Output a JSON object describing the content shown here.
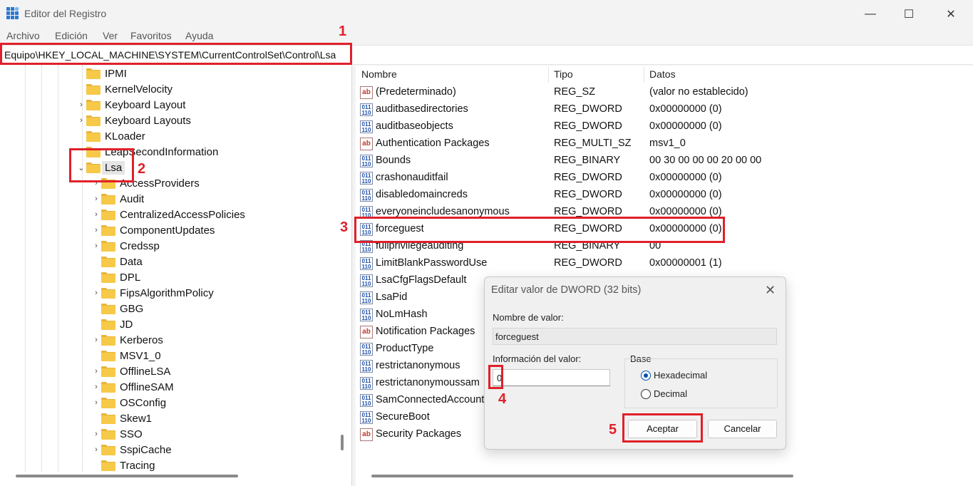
{
  "window": {
    "title": "Editor del Registro",
    "controls": {
      "minimize": "—",
      "maximize": "☐",
      "close": "✕"
    }
  },
  "menu": [
    "Archivo",
    "Edición",
    "Ver",
    "Favoritos",
    "Ayuda"
  ],
  "address": "Equipo\\HKEY_LOCAL_MACHINE\\SYSTEM\\CurrentControlSet\\Control\\Lsa",
  "annotations": {
    "n1": "1",
    "n2": "2",
    "n3": "3",
    "n4": "4",
    "n5": "5",
    "color": "#e0202a"
  },
  "tree": {
    "parents": [
      {
        "label": "IPMI",
        "expandable": false
      },
      {
        "label": "KernelVelocity",
        "expandable": false
      },
      {
        "label": "Keyboard Layout",
        "expandable": true
      },
      {
        "label": "Keyboard Layouts",
        "expandable": true
      },
      {
        "label": "KLoader",
        "expandable": false
      },
      {
        "label": "LeapSecondInformation",
        "expandable": false
      },
      {
        "label": "Lsa",
        "expandable": true,
        "expanded": true,
        "selected": true
      }
    ],
    "children": [
      {
        "label": "AccessProviders",
        "expandable": true
      },
      {
        "label": "Audit",
        "expandable": true
      },
      {
        "label": "CentralizedAccessPolicies",
        "expandable": true
      },
      {
        "label": "ComponentUpdates",
        "expandable": true
      },
      {
        "label": "Credssp",
        "expandable": true
      },
      {
        "label": "Data",
        "expandable": false
      },
      {
        "label": "DPL",
        "expandable": false
      },
      {
        "label": "FipsAlgorithmPolicy",
        "expandable": true
      },
      {
        "label": "GBG",
        "expandable": false
      },
      {
        "label": "JD",
        "expandable": false
      },
      {
        "label": "Kerberos",
        "expandable": true
      },
      {
        "label": "MSV1_0",
        "expandable": false
      },
      {
        "label": "OfflineLSA",
        "expandable": true
      },
      {
        "label": "OfflineSAM",
        "expandable": true
      },
      {
        "label": "OSConfig",
        "expandable": true
      },
      {
        "label": "Skew1",
        "expandable": false
      },
      {
        "label": "SSO",
        "expandable": true
      },
      {
        "label": "SspiCache",
        "expandable": true
      },
      {
        "label": "Tracing",
        "expandable": false
      }
    ]
  },
  "list": {
    "headers": {
      "name": "Nombre",
      "type": "Tipo",
      "data": "Datos"
    },
    "rows": [
      {
        "icon": "string-icon",
        "name": "(Predeterminado)",
        "type": "REG_SZ",
        "data": "(valor no establecido)"
      },
      {
        "icon": "binary-icon",
        "name": "auditbasedirectories",
        "type": "REG_DWORD",
        "data": "0x00000000 (0)"
      },
      {
        "icon": "binary-icon",
        "name": "auditbaseobjects",
        "type": "REG_DWORD",
        "data": "0x00000000 (0)"
      },
      {
        "icon": "string-icon",
        "name": "Authentication Packages",
        "type": "REG_MULTI_SZ",
        "data": "msv1_0"
      },
      {
        "icon": "binary-icon",
        "name": "Bounds",
        "type": "REG_BINARY",
        "data": "00 30 00 00 00 20 00 00"
      },
      {
        "icon": "binary-icon",
        "name": "crashonauditfail",
        "type": "REG_DWORD",
        "data": "0x00000000 (0)"
      },
      {
        "icon": "binary-icon",
        "name": "disabledomaincreds",
        "type": "REG_DWORD",
        "data": "0x00000000 (0)"
      },
      {
        "icon": "binary-icon",
        "name": "everyoneincludesanonymous",
        "type": "REG_DWORD",
        "data": "0x00000000 (0)"
      },
      {
        "icon": "binary-icon",
        "name": "forceguest",
        "type": "REG_DWORD",
        "data": "0x00000000 (0)"
      },
      {
        "icon": "binary-icon",
        "name": "fullprivilegeauditing",
        "type": "REG_BINARY",
        "data": "00"
      },
      {
        "icon": "binary-icon",
        "name": "LimitBlankPasswordUse",
        "type": "REG_DWORD",
        "data": "0x00000001 (1)"
      },
      {
        "icon": "binary-icon",
        "name": "LsaCfgFlagsDefault",
        "type": "",
        "data": ""
      },
      {
        "icon": "binary-icon",
        "name": "LsaPid",
        "type": "",
        "data": ""
      },
      {
        "icon": "binary-icon",
        "name": "NoLmHash",
        "type": "",
        "data": ""
      },
      {
        "icon": "string-icon",
        "name": "Notification Packages",
        "type": "",
        "data": ""
      },
      {
        "icon": "binary-icon",
        "name": "ProductType",
        "type": "",
        "data": ""
      },
      {
        "icon": "binary-icon",
        "name": "restrictanonymous",
        "type": "",
        "data": ""
      },
      {
        "icon": "binary-icon",
        "name": "restrictanonymoussam",
        "type": "",
        "data": ""
      },
      {
        "icon": "binary-icon",
        "name": "SamConnectedAccounts",
        "type": "",
        "data": ""
      },
      {
        "icon": "binary-icon",
        "name": "SecureBoot",
        "type": "",
        "data": ""
      },
      {
        "icon": "string-icon",
        "name": "Security Packages",
        "type": "",
        "data": ""
      }
    ]
  },
  "dialog": {
    "title": "Editar valor de DWORD (32 bits)",
    "close": "✕",
    "name_label": "Nombre de valor:",
    "name_value": "forceguest",
    "value_label": "Información del valor:",
    "value": "0",
    "base_label": "Base",
    "base_options": [
      {
        "label": "Hexadecimal",
        "selected": true
      },
      {
        "label": "Decimal",
        "selected": false
      }
    ],
    "ok": "Aceptar",
    "cancel": "Cancelar"
  }
}
